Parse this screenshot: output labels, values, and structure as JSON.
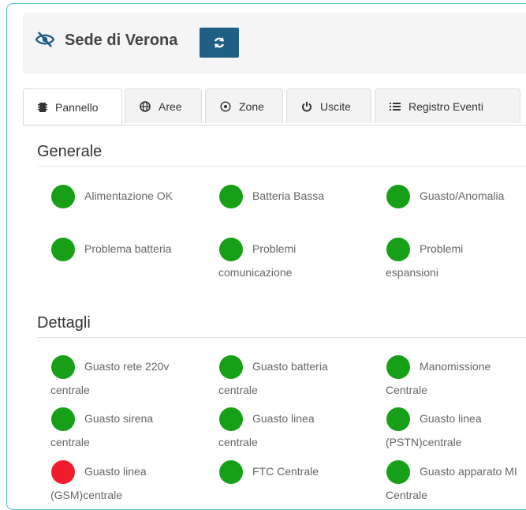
{
  "header": {
    "title": "Sede di Verona"
  },
  "tabs": [
    {
      "label": "Pannello",
      "icon": "chip-icon"
    },
    {
      "label": "Aree",
      "icon": "globe-icon"
    },
    {
      "label": "Zone",
      "icon": "target-icon"
    },
    {
      "label": "Uscite",
      "icon": "power-icon"
    },
    {
      "label": "Registro Eventi",
      "icon": "list-icon"
    }
  ],
  "sections": {
    "generale": {
      "title": "Generale",
      "items": [
        {
          "label": "Alimentazione OK",
          "status": "green"
        },
        {
          "label": "Batteria Bassa",
          "status": "green"
        },
        {
          "label": "Guasto/Anomalia",
          "status": "green"
        },
        {
          "label": "Problema batteria",
          "status": "green"
        },
        {
          "label": "Problemi comunicazione",
          "status": "green"
        },
        {
          "label": "Problemi espansioni",
          "status": "green"
        }
      ]
    },
    "dettagli": {
      "title": "Dettagli",
      "items": [
        {
          "label": "Guasto rete 220v centrale",
          "status": "green"
        },
        {
          "label": "Guasto batteria centrale",
          "status": "green"
        },
        {
          "label": "Manomissione Centrale",
          "status": "green"
        },
        {
          "label": "Guasto sirena centrale",
          "status": "green"
        },
        {
          "label": "Guasto linea centrale",
          "status": "green"
        },
        {
          "label": "Guasto linea (PSTN)centrale",
          "status": "green"
        },
        {
          "label": "Guasto linea (GSM)centrale",
          "status": "red"
        },
        {
          "label": "FTC Centrale",
          "status": "green"
        },
        {
          "label": "Guasto apparato MI Centrale",
          "status": "green"
        }
      ]
    }
  },
  "colors": {
    "ok": "#17a017",
    "alarm": "#ee1c2c",
    "accent": "#1f5f86"
  }
}
